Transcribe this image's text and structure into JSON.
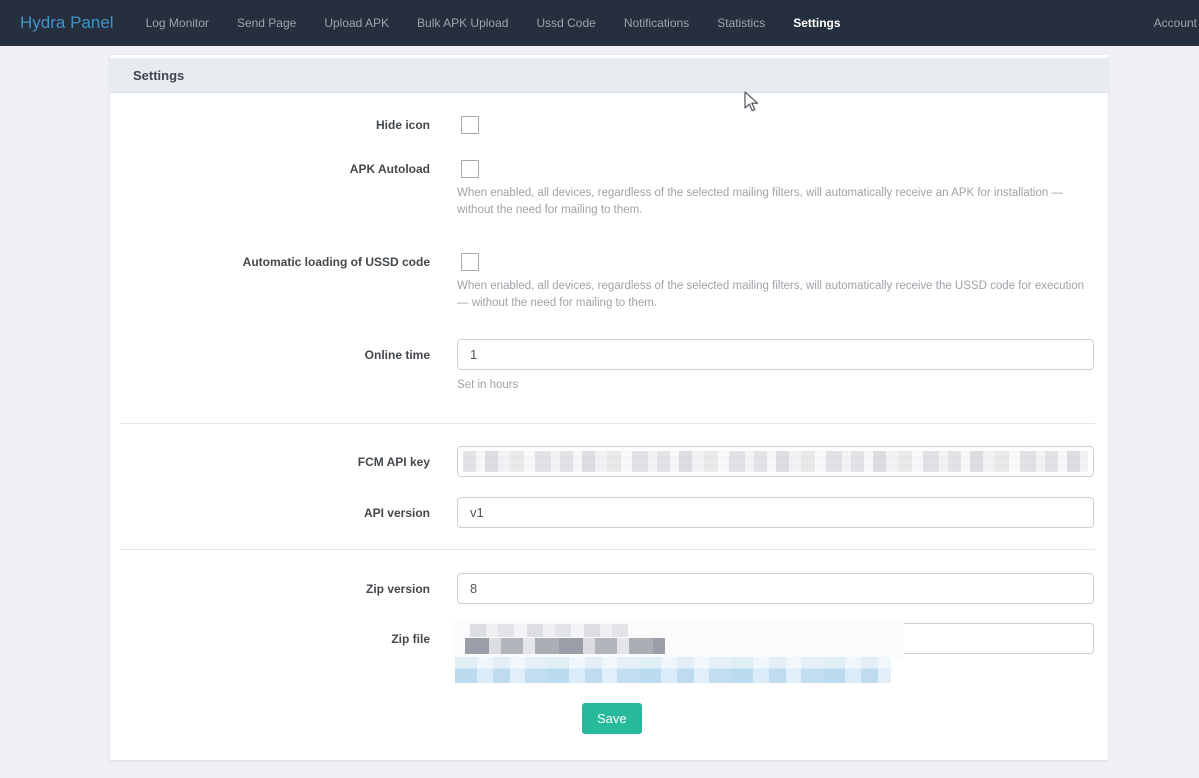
{
  "navbar": {
    "brand": "Hydra Panel",
    "items": [
      {
        "label": "Log Monitor",
        "active": false
      },
      {
        "label": "Send Page",
        "active": false
      },
      {
        "label": "Upload APK",
        "active": false
      },
      {
        "label": "Bulk APK Upload",
        "active": false
      },
      {
        "label": "Ussd Code",
        "active": false
      },
      {
        "label": "Notifications",
        "active": false
      },
      {
        "label": "Statistics",
        "active": false
      },
      {
        "label": "Settings",
        "active": true
      }
    ],
    "account_label": "Account"
  },
  "panel": {
    "title": "Settings"
  },
  "form": {
    "hide_icon": {
      "label": "Hide icon",
      "checked": false
    },
    "apk_autoload": {
      "label": "APK Autoload",
      "checked": false,
      "help": "When enabled, all devices, regardless of the selected mailing filters, will automatically receive an APK for installation — without the need for mailing to them."
    },
    "ussd_autoload": {
      "label": "Automatic loading of USSD code",
      "checked": false,
      "help": "When enabled, all devices, regardless of the selected mailing filters, will automatically receive the USSD code for execution — without the need for mailing to them."
    },
    "online_time": {
      "label": "Online time",
      "value": "1",
      "help": "Set in hours"
    },
    "fcm_api_key": {
      "label": "FCM API key",
      "value": "",
      "redacted": true
    },
    "api_version": {
      "label": "API version",
      "value": "v1"
    },
    "zip_version": {
      "label": "Zip version",
      "value": "8"
    },
    "zip_file": {
      "label": "Zip file",
      "value": "",
      "redacted": true
    },
    "save_label": "Save"
  },
  "colors": {
    "navbar_bg": "#262f3d",
    "brand_blue": "#3f94c9",
    "save_green": "#26b99a",
    "page_bg": "#eef0f4"
  }
}
